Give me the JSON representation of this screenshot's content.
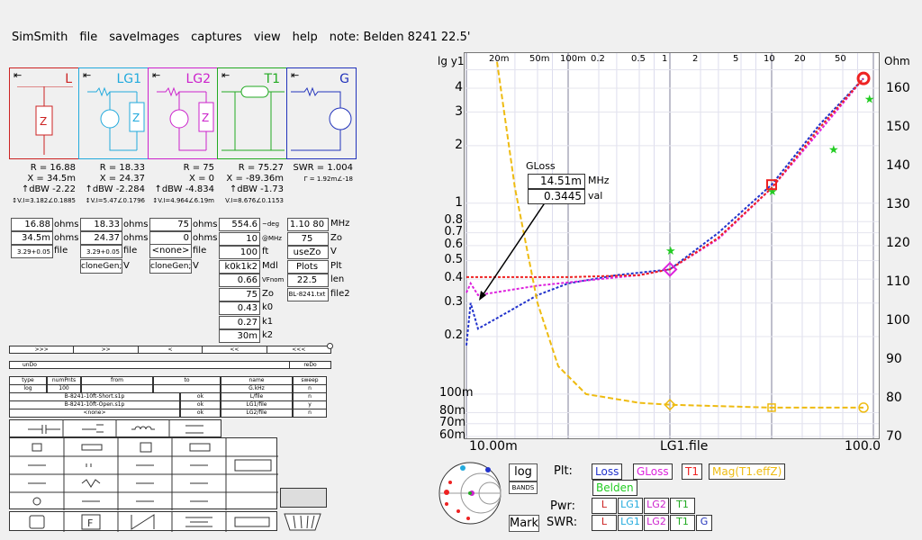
{
  "menu": {
    "items": [
      "SimSmith",
      "file",
      "saveImages",
      "captures",
      "view",
      "help"
    ],
    "note": "note: Belden 8241 22.5'"
  },
  "components": [
    {
      "label": "L",
      "color": "#cc2222",
      "R": "R = 16.88",
      "X": "X = 34.5m",
      "dbw": "↑dBW -2.22",
      "v": "↕V.I=3.182∠0.1885",
      "r_val": "16.88",
      "x_val": "34.5m",
      "file_val": "",
      "unit_r": "ohms",
      "unit_x": "ohms",
      "file_label": "file"
    },
    {
      "label": "LG1",
      "color": "#22aadd",
      "R": "R = 18.33",
      "X": "X = 24.37",
      "dbw": "↑dBW -2.284",
      "v": "↕V.I=5.47∠0.1796",
      "r_val": "18.33",
      "x_val": "24.37",
      "file_val": "",
      "unit_r": "ohms",
      "unit_x": "ohms",
      "file_label": "file",
      "clone": "cloneGen;",
      "v_label": "V"
    },
    {
      "label": "LG2",
      "color": "#cc22cc",
      "R": "R = 75",
      "X": "X = 0",
      "dbw": "↑dBW -4.834",
      "v": "↕V.I=4.964∠6.19m",
      "r_val": "75",
      "x_val": "0",
      "file_val": "<none>",
      "unit_r": "ohms",
      "unit_x": "ohms",
      "file_label": "file",
      "clone": "cloneGen;",
      "v_label": "V"
    },
    {
      "label": "T1",
      "color": "#22aa22",
      "R": "R = 75.27",
      "X": "X = -89.36m",
      "dbw": "↑dBW -1.73",
      "v": "V.I=8.676∠0.1153"
    },
    {
      "label": "G",
      "color": "#2233bb",
      "R": "SWR = 1.004",
      "X": "Γ = 1.92m∠-18"
    }
  ],
  "t1_fields": [
    {
      "val": "554.6",
      "unit": "~deg"
    },
    {
      "val": "10",
      "unit": "@MHz"
    },
    {
      "val": "100",
      "unit": "ft"
    },
    {
      "val": "k0k1k2",
      "unit": "Mdl"
    },
    {
      "val": "0.66",
      "unit": "VFnom"
    },
    {
      "val": "75",
      "unit": "Zo"
    },
    {
      "val": "0.43",
      "unit": "k0"
    },
    {
      "val": "0.27",
      "unit": "k1"
    },
    {
      "val": "30m",
      "unit": "k2"
    }
  ],
  "g_fields": [
    {
      "val": "1.10 80",
      "unit": "MHz"
    },
    {
      "val": "75",
      "unit": "Zo"
    },
    {
      "val": "useZo",
      "unit": "V"
    },
    {
      "val": "Plots",
      "unit": "Plt"
    },
    {
      "val": "22.5",
      "unit": "len"
    },
    {
      "val": "BL-8241.txt",
      "unit": "file2"
    }
  ],
  "lower_buttons": {
    "undo": "unDo",
    "redo": "reDo",
    "play": [
      ">>>",
      ">>",
      "<",
      "<<",
      "<<<"
    ]
  },
  "table": {
    "headers": [
      "type",
      "numPnts",
      "from",
      "to",
      "name",
      "sweep"
    ],
    "row1": [
      "log",
      "100",
      "",
      "",
      "G.kHz",
      "n"
    ],
    "rows": [
      {
        "file": "B-8241-10ft-Short.s1p",
        "mid": "ok",
        "name": "L/file",
        "sw": "n"
      },
      {
        "file": "B-8241-10ft-Open.s1p",
        "mid": "ok",
        "name": "LG1/file",
        "sw": "y"
      },
      {
        "file": "<none>",
        "mid": "ok",
        "name": "LG2/file",
        "sw": "n"
      }
    ]
  },
  "chart_data": {
    "type": "line",
    "ylabel_left": "lg y1",
    "ylabel_right": "Ohm",
    "xlabel_mid": "LG1.file",
    "x_ticks_bottom": [
      "10.00m",
      "LG1.file",
      "100.0"
    ],
    "x_ticks_top": [
      "20m",
      "50m",
      "100m",
      "0.2",
      "0.5",
      "1",
      "2",
      "5",
      "10",
      "20",
      "50"
    ],
    "y_ticks_left": [
      "4",
      "3",
      "2",
      "1",
      "0.8",
      "0.7",
      "0.6",
      "0.5",
      "0.4",
      "0.3",
      "0.2",
      "100m",
      "80m",
      "70m",
      "60m"
    ],
    "y_ticks_right": [
      "160",
      "150",
      "140",
      "130",
      "120",
      "110",
      "100",
      "90",
      "80",
      "70"
    ],
    "tooltip": {
      "title": "GLoss",
      "freq": "14.51m",
      "freq_unit": "MHz",
      "val": "0.3445",
      "val_unit": "val"
    },
    "series": [
      {
        "name": "Loss",
        "color": "#2233cc",
        "points": [
          [
            0.01,
            0.18
          ],
          [
            0.011,
            0.3
          ],
          [
            0.013,
            0.22
          ],
          [
            0.02,
            0.25
          ],
          [
            0.05,
            0.33
          ],
          [
            0.1,
            0.38
          ],
          [
            0.3,
            0.42
          ],
          [
            1,
            0.45
          ],
          [
            3,
            0.7
          ],
          [
            10,
            1.25
          ],
          [
            30,
            2.6
          ],
          [
            80,
            4.5
          ]
        ]
      },
      {
        "name": "GLoss",
        "color": "#dd22dd",
        "points": [
          [
            0.01,
            0.34
          ],
          [
            0.011,
            0.38
          ],
          [
            0.013,
            0.33
          ],
          [
            0.05,
            0.37
          ],
          [
            0.2,
            0.4
          ],
          [
            0.5,
            0.42
          ],
          [
            1,
            0.45
          ],
          [
            3,
            0.65
          ],
          [
            10,
            1.2
          ],
          [
            30,
            2.4
          ],
          [
            80,
            4.5
          ]
        ]
      },
      {
        "name": "T1",
        "color": "#ee2222",
        "points": [
          [
            0.01,
            0.41
          ],
          [
            0.1,
            0.41
          ],
          [
            0.5,
            0.42
          ],
          [
            1,
            0.45
          ],
          [
            3,
            0.66
          ],
          [
            10,
            1.2
          ],
          [
            30,
            2.5
          ],
          [
            80,
            4.5
          ]
        ]
      },
      {
        "name": "Mag(T1.effZ)",
        "color": "#eebb11",
        "points": [
          [
            0.02,
            5.5
          ],
          [
            0.03,
            1.2
          ],
          [
            0.05,
            0.3
          ],
          [
            0.08,
            0.14
          ],
          [
            0.15,
            0.1
          ],
          [
            0.5,
            0.09
          ],
          [
            1,
            0.088
          ],
          [
            10,
            0.085
          ],
          [
            80,
            0.085
          ]
        ]
      }
    ],
    "markers_green": [
      [
        1,
        0.56
      ],
      [
        10,
        1.15
      ],
      [
        40,
        1.9
      ],
      [
        90,
        3.5
      ]
    ]
  },
  "bottom": {
    "log_btn": "log",
    "bands_btn": "BANDS",
    "mark_btn": "Mark",
    "plt_label": "Plt:",
    "pwr_label": "Pwr:",
    "swr_label": "SWR:",
    "legend": [
      {
        "label": "Loss",
        "color": "#2233cc"
      },
      {
        "label": "GLoss",
        "color": "#dd22dd"
      },
      {
        "label": "T1",
        "color": "#ee2222"
      },
      {
        "label": "Mag(T1.effZ)",
        "color": "#eebb11"
      },
      {
        "label": "Belden",
        "color": "#22cc22"
      }
    ],
    "pwr_boxes": [
      {
        "label": "L",
        "color": "#cc2222"
      },
      {
        "label": "LG1",
        "color": "#22aadd"
      },
      {
        "label": "LG2",
        "color": "#cc22cc"
      },
      {
        "label": "T1",
        "color": "#22aa22"
      }
    ],
    "swr_boxes": [
      {
        "label": "L",
        "color": "#cc2222"
      },
      {
        "label": "LG1",
        "color": "#22aadd"
      },
      {
        "label": "LG2",
        "color": "#cc22cc"
      },
      {
        "label": "T1",
        "color": "#22aa22"
      },
      {
        "label": "G",
        "color": "#2233bb"
      }
    ]
  }
}
